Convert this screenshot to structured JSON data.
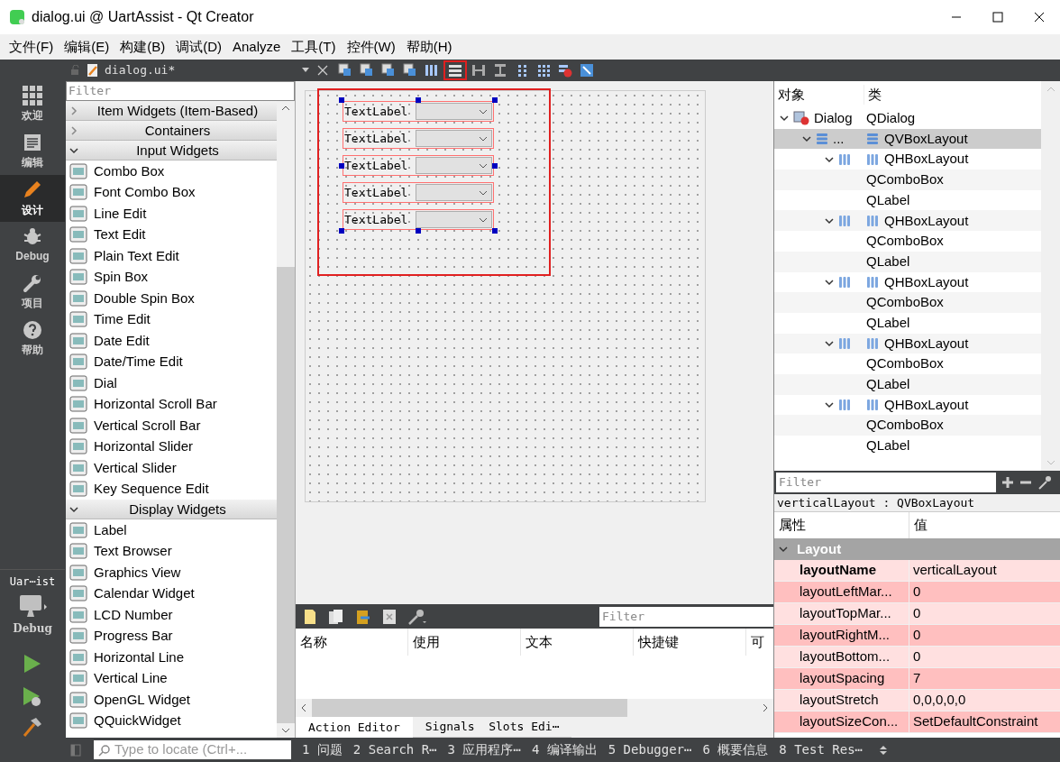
{
  "window": {
    "title": "dialog.ui @ UartAssist - Qt Creator"
  },
  "menu": [
    "文件(F)",
    "编辑(E)",
    "构建(B)",
    "调试(D)",
    "Analyze",
    "工具(T)",
    "控件(W)",
    "帮助(H)"
  ],
  "editor_tab": {
    "file": "dialog.ui*"
  },
  "toolbar": [
    {
      "kind": "widget",
      "selected": false
    },
    {
      "kind": "widget",
      "selected": false
    },
    {
      "kind": "widget",
      "selected": false
    },
    {
      "kind": "widget",
      "selected": false
    },
    {
      "kind": "hbox",
      "selected": false
    },
    {
      "kind": "vbox",
      "selected": true
    },
    {
      "kind": "hsplit",
      "selected": false
    },
    {
      "kind": "vsplit",
      "selected": false
    },
    {
      "kind": "form",
      "selected": false
    },
    {
      "kind": "grid",
      "selected": false
    },
    {
      "kind": "break",
      "selected": false
    },
    {
      "kind": "adjust",
      "selected": false
    }
  ],
  "mode_bar": [
    {
      "kind": "grid",
      "label": "欢迎",
      "selected": false
    },
    {
      "kind": "edit",
      "label": "编辑",
      "selected": false
    },
    {
      "kind": "pencil",
      "label": "设计",
      "selected": true
    },
    {
      "kind": "bug",
      "label": "Debug",
      "selected": false
    },
    {
      "kind": "wrench",
      "label": "项目",
      "selected": false
    },
    {
      "kind": "help",
      "label": "帮助",
      "selected": false
    }
  ],
  "kit": {
    "name": "Uar⋯ist",
    "build": "Debug"
  },
  "widget_box": {
    "filter_placeholder": "Filter",
    "groups": [
      {
        "title": "Item Widgets (Item-Based)",
        "expanded": false
      },
      {
        "title": "Containers",
        "expanded": false
      },
      {
        "title": "Input Widgets",
        "expanded": true,
        "items": [
          "Combo Box",
          "Font Combo Box",
          "Line Edit",
          "Text Edit",
          "Plain Text Edit",
          "Spin Box",
          "Double Spin Box",
          "Time Edit",
          "Date Edit",
          "Date/Time Edit",
          "Dial",
          "Horizontal Scroll Bar",
          "Vertical Scroll Bar",
          "Horizontal Slider",
          "Vertical Slider",
          "Key Sequence Edit"
        ]
      },
      {
        "title": "Display Widgets",
        "expanded": true,
        "items": [
          "Label",
          "Text Browser",
          "Graphics View",
          "Calendar Widget",
          "LCD Number",
          "Progress Bar",
          "Horizontal Line",
          "Vertical Line",
          "OpenGL Widget",
          "QQuickWidget"
        ]
      }
    ]
  },
  "form": {
    "rows": [
      {
        "label": "TextLabel"
      },
      {
        "label": "TextLabel"
      },
      {
        "label": "TextLabel"
      },
      {
        "label": "TextLabel"
      },
      {
        "label": "TextLabel"
      }
    ]
  },
  "action_editor": {
    "filter_placeholder": "Filter",
    "columns": [
      "名称",
      "使用",
      "文本",
      "快捷键",
      "可"
    ],
    "tabs": [
      {
        "label": "Action Editor",
        "selected": true
      },
      {
        "label": "Signals  Slots Edi⋯",
        "selected": false
      }
    ]
  },
  "object_inspector": {
    "columns": [
      "对象",
      "类"
    ],
    "tree": [
      {
        "object": "Dialog",
        "class": "QDialog",
        "kind": "dialog",
        "expanded": true,
        "selected": false,
        "children": [
          {
            "object": "...",
            "class": "QVBoxLayout",
            "kind": "vbox",
            "expanded": true,
            "selected": true,
            "children": [
              {
                "class": "QHBoxLayout",
                "kind": "hbox",
                "expanded": true,
                "selected": false,
                "children": [
                  {
                    "class": "QComboBox",
                    "selected": false
                  },
                  {
                    "class": "QLabel",
                    "selected": false
                  }
                ]
              },
              {
                "class": "QHBoxLayout",
                "kind": "hbox",
                "expanded": true,
                "selected": false,
                "children": [
                  {
                    "class": "QComboBox",
                    "selected": false
                  },
                  {
                    "class": "QLabel",
                    "selected": false
                  }
                ]
              },
              {
                "class": "QHBoxLayout",
                "kind": "hbox",
                "expanded": true,
                "selected": false,
                "children": [
                  {
                    "class": "QComboBox",
                    "selected": false
                  },
                  {
                    "class": "QLabel",
                    "selected": false
                  }
                ]
              },
              {
                "class": "QHBoxLayout",
                "kind": "hbox",
                "expanded": true,
                "selected": false,
                "children": [
                  {
                    "class": "QComboBox",
                    "selected": false
                  },
                  {
                    "class": "QLabel",
                    "selected": false
                  }
                ]
              },
              {
                "class": "QHBoxLayout",
                "kind": "hbox",
                "expanded": true,
                "selected": false,
                "children": [
                  {
                    "class": "QComboBox",
                    "selected": false
                  },
                  {
                    "class": "QLabel",
                    "selected": false
                  }
                ]
              }
            ]
          }
        ]
      }
    ]
  },
  "property_editor": {
    "filter_placeholder": "Filter",
    "object_title": "verticalLayout : QVBoxLayout",
    "columns": [
      "属性",
      "值"
    ],
    "section": {
      "title": "Layout",
      "expanded": true
    },
    "rows": [
      {
        "name": "layoutName",
        "value": "verticalLayout",
        "modified": true
      },
      {
        "name": "layoutLeftMar...",
        "value": "0",
        "modified": false
      },
      {
        "name": "layoutTopMar...",
        "value": "0",
        "modified": false
      },
      {
        "name": "layoutRightM...",
        "value": "0",
        "modified": false
      },
      {
        "name": "layoutBottom...",
        "value": "0",
        "modified": false
      },
      {
        "name": "layoutSpacing",
        "value": "7",
        "modified": false
      },
      {
        "name": "layoutStretch",
        "value": "0,0,0,0,0",
        "modified": false
      },
      {
        "name": "layoutSizeCon...",
        "value": "SetDefaultConstraint",
        "modified": false
      }
    ]
  },
  "status_bar": {
    "locator_placeholder": "Type to locate (Ctrl+...",
    "panes": [
      "1 问题",
      "2 Search R⋯",
      "3 应用程序⋯",
      "4 编译输出",
      "5 Debugger⋯",
      "6 概要信息",
      "8 Test Res⋯"
    ]
  }
}
